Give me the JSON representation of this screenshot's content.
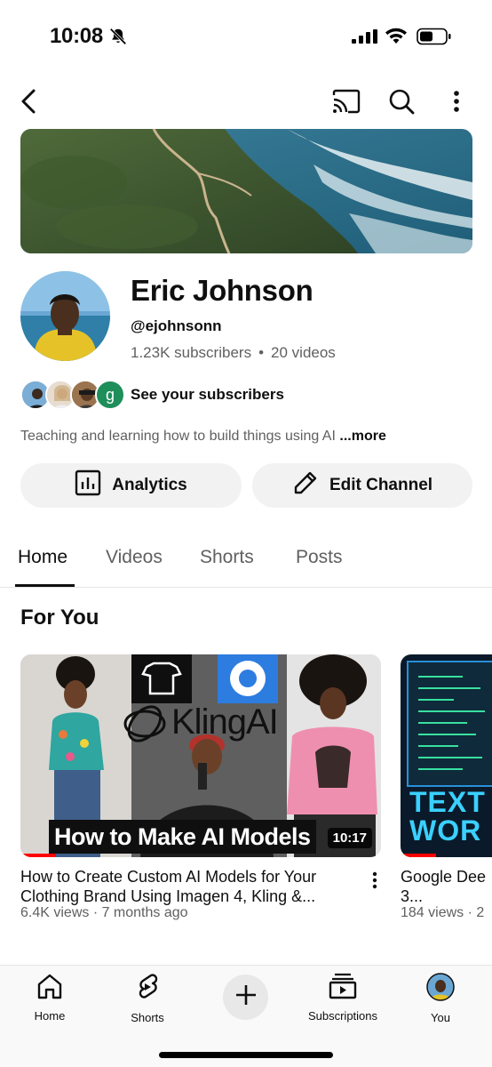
{
  "status_bar": {
    "time": "10:08",
    "icons": [
      "bell-slash-icon",
      "cellular-signal-icon",
      "wifi-icon",
      "battery-icon"
    ]
  },
  "app_bar": {
    "icons": [
      "back-arrow-icon",
      "cast-icon",
      "search-icon",
      "more-vert-icon"
    ]
  },
  "channel": {
    "name": "Eric Johnson",
    "handle": "@ejohnsonn",
    "subscribers": "1.23K subscribers",
    "separator": "•",
    "videos": "20 videos",
    "see_subscribers": "See your subscribers",
    "subscriber_initial": "g",
    "description": "Teaching and learning how to build things using AI",
    "more_label": "...more"
  },
  "actions": {
    "analytics_label": "Analytics",
    "edit_label": "Edit Channel"
  },
  "tabs": [
    {
      "label": "Home",
      "active": true
    },
    {
      "label": "Videos",
      "active": false
    },
    {
      "label": "Shorts",
      "active": false
    },
    {
      "label": "Posts",
      "active": false
    }
  ],
  "section_title": "For You",
  "videos": [
    {
      "thumb_text": "How to Make AI Models",
      "thumb_brand": "KlingAI",
      "duration": "10:17",
      "title": "How to Create Custom AI Models for Your Clothing Brand Using Imagen 4, Kling &...",
      "meta": "6.4K views · 7 months ago"
    },
    {
      "thumb_text": "TEXT WOR",
      "title": "Google Dee 3...",
      "meta": "184 views · 2"
    }
  ],
  "bottom_nav": [
    {
      "label": "Home",
      "icon": "home-icon"
    },
    {
      "label": "Shorts",
      "icon": "shorts-icon"
    },
    {
      "label": "",
      "icon": "create-plus-icon"
    },
    {
      "label": "Subscriptions",
      "icon": "subscriptions-icon"
    },
    {
      "label": "You",
      "icon": "profile-avatar-icon"
    }
  ],
  "colors": {
    "text_primary": "#0f0f0f",
    "text_secondary": "#606060",
    "button_bg": "#f2f2f2",
    "progress": "#ff0000",
    "subscriber_green": "#1e8e5a"
  }
}
